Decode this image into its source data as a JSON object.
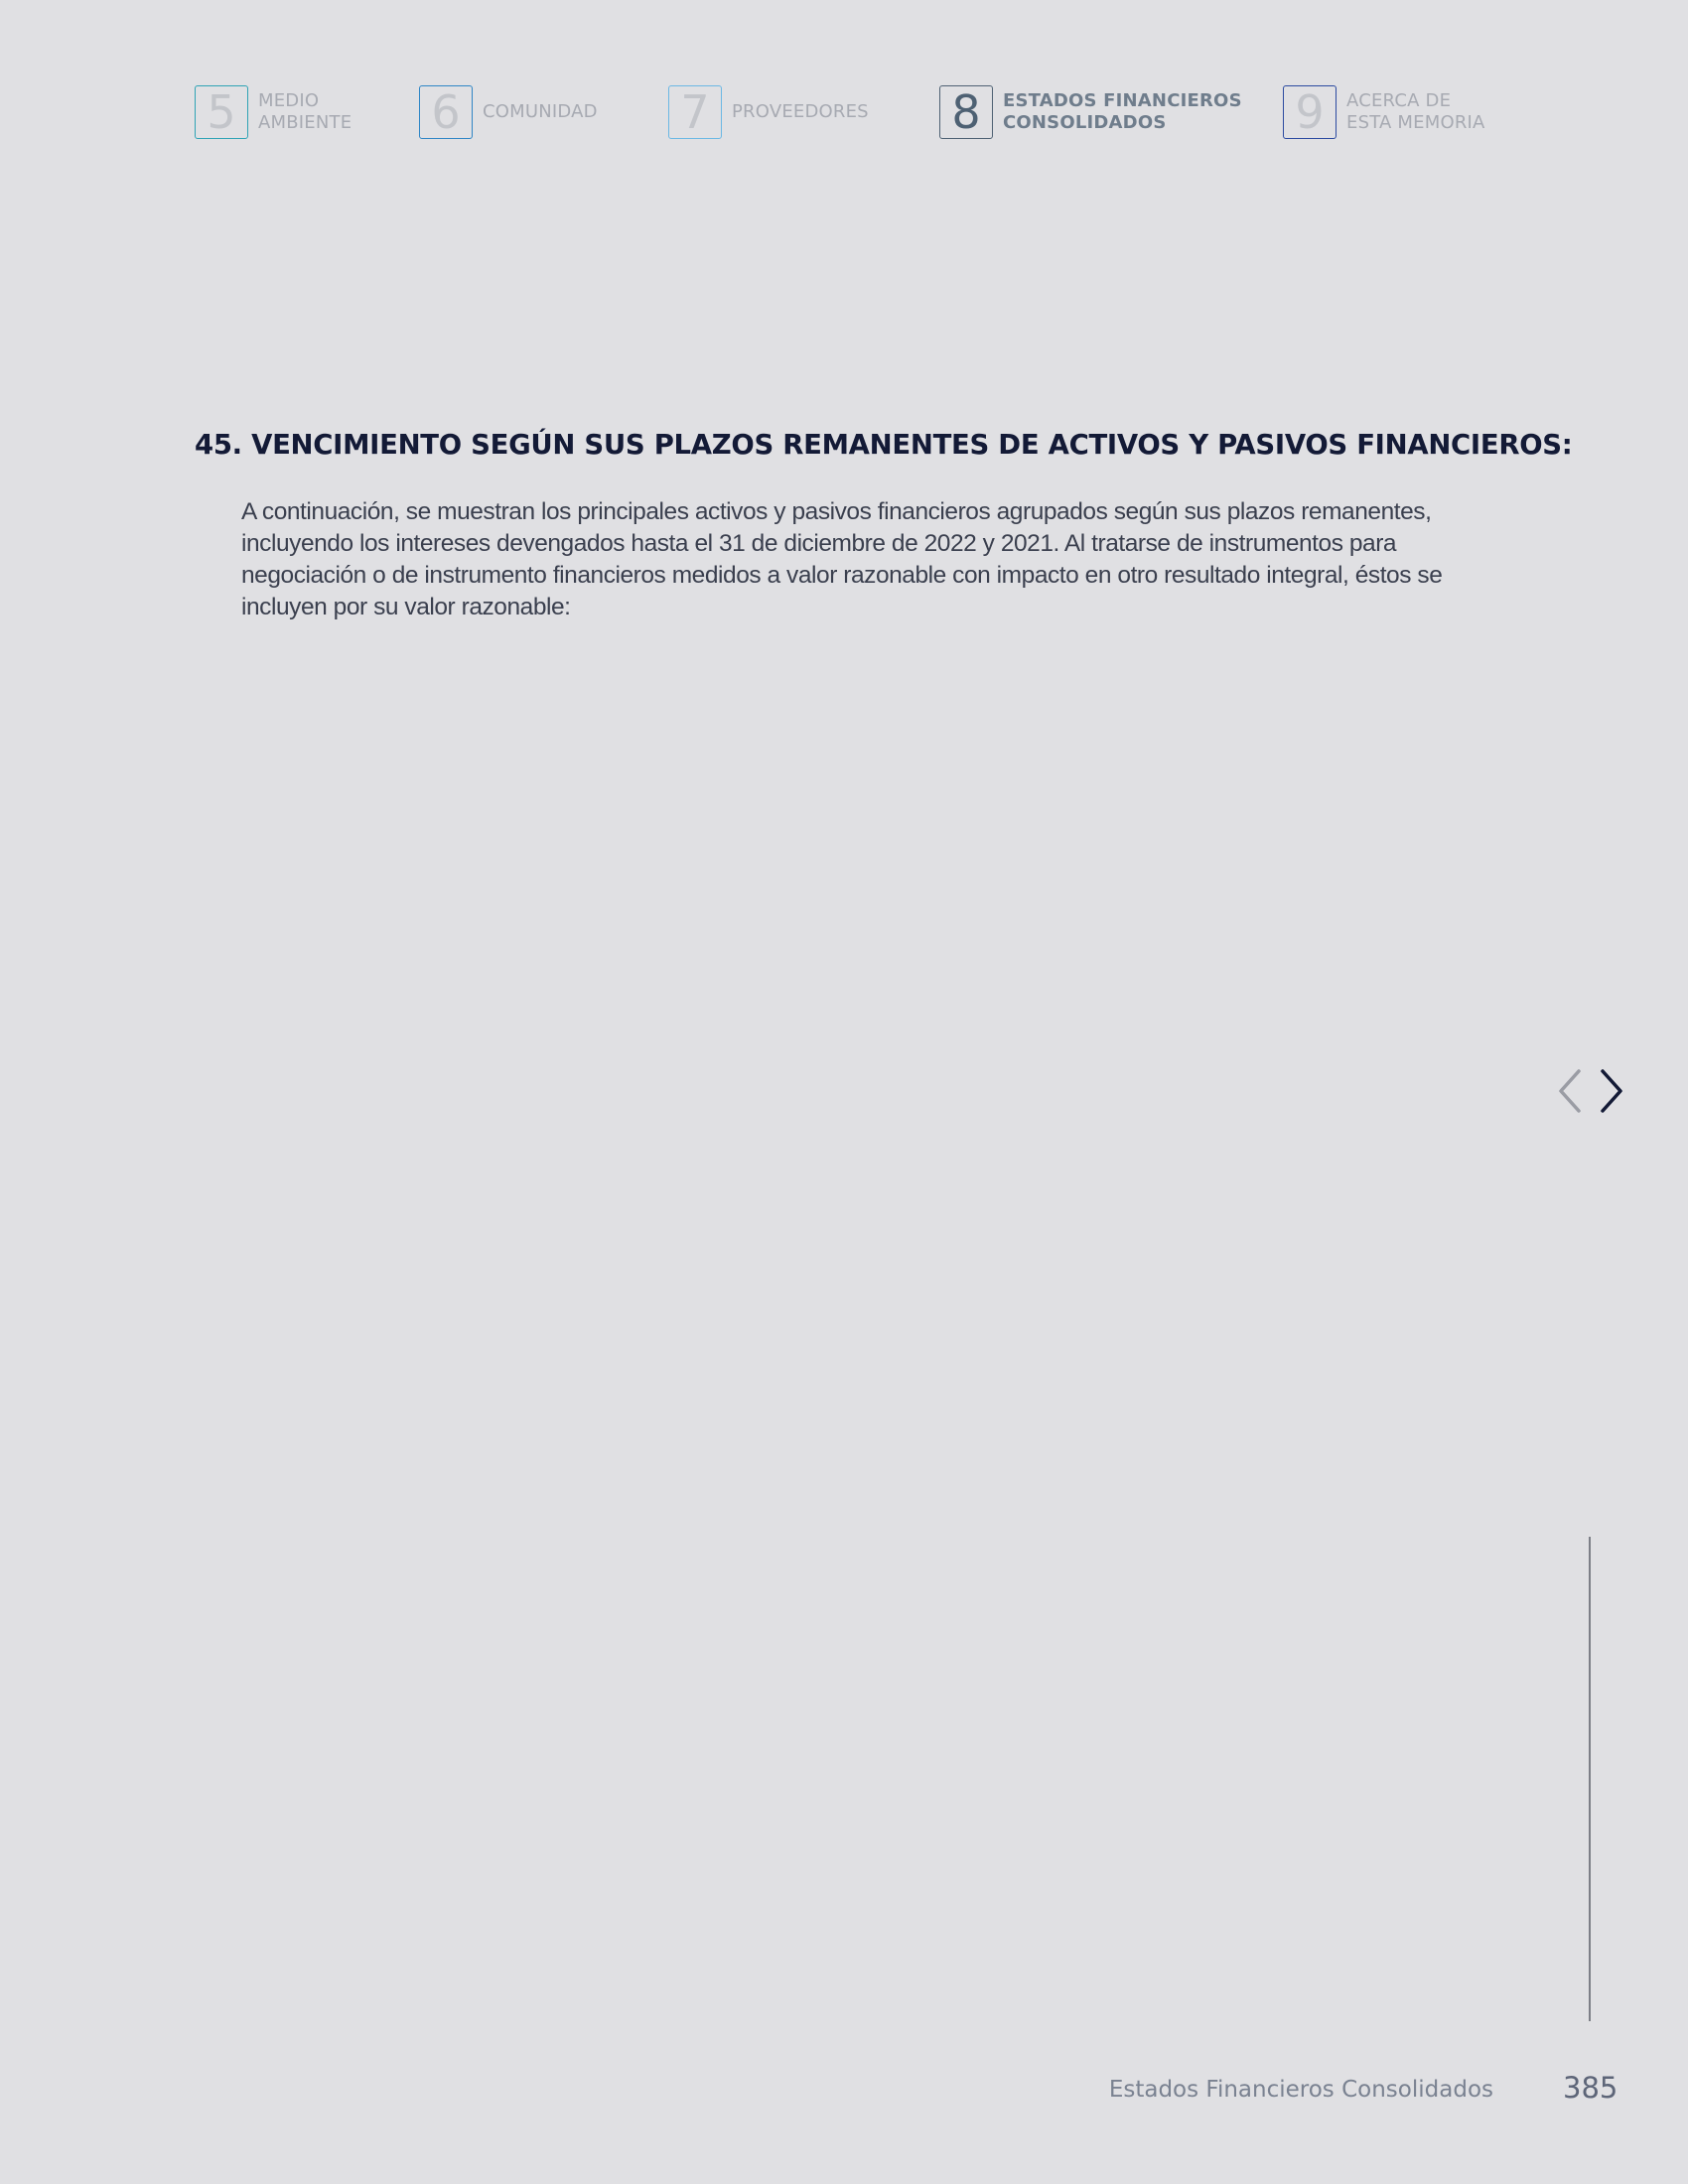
{
  "nav": {
    "items": [
      {
        "number": "5",
        "line1": "MEDIO",
        "line2": "AMBIENTE"
      },
      {
        "number": "6",
        "line1": "COMUNIDAD",
        "line2": ""
      },
      {
        "number": "7",
        "line1": "PROVEEDORES",
        "line2": ""
      },
      {
        "number": "8",
        "line1": "ESTADOS FINANCIEROS",
        "line2": "CONSOLIDADOS"
      },
      {
        "number": "9",
        "line1": "ACERCA DE",
        "line2": "ESTA MEMORIA"
      }
    ],
    "active_index": 3,
    "colors": {
      "box5": "#2fa3b5",
      "box6": "#2f86c6",
      "box7": "#6bb8e4",
      "box8": "#4e6173",
      "box9": "#2b4aa0"
    }
  },
  "section": {
    "heading": "45. VENCIMIENTO SEGÚN SUS PLAZOS REMANENTES DE ACTIVOS Y PASIVOS FINANCIEROS:",
    "body": "A continuación, se muestran los principales activos y pasivos financieros agrupados según sus plazos remanentes, incluyendo los intereses devengados hasta el 31 de diciembre de 2022 y 2021. Al tratarse de instrumentos para negociación o de instrumento financieros medidos a valor razonable con impacto en otro resultado integral, éstos se incluyen por su valor razonable:"
  },
  "pager": {
    "prev_icon": "chevron-left-icon",
    "next_icon": "chevron-right-icon"
  },
  "footer": {
    "title": "Estados Financieros Consolidados",
    "page_number": "385"
  },
  "colors": {
    "background": "#e0e0e3",
    "heading": "#131a36",
    "body_text": "#3a3f4e"
  }
}
